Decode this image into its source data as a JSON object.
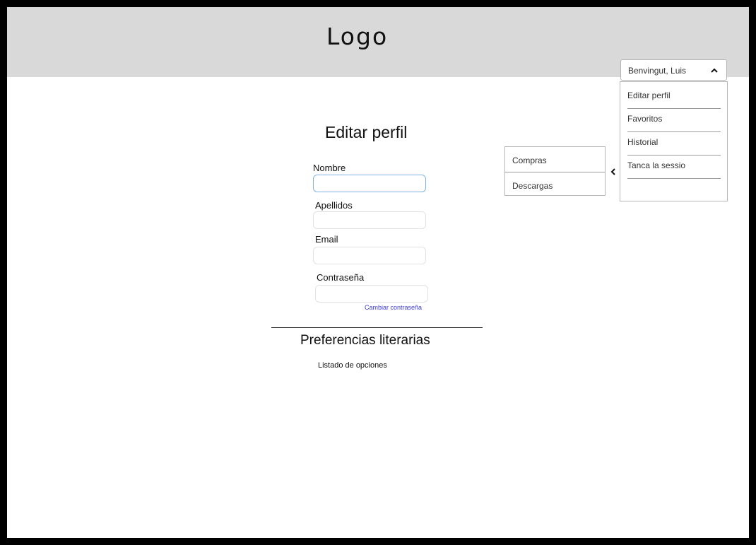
{
  "header": {
    "logo": "Logo"
  },
  "user_menu": {
    "greeting": "Benvingut, Luis",
    "items": [
      {
        "label": "Editar perfil"
      },
      {
        "label": "Favoritos"
      },
      {
        "label": "Historial"
      },
      {
        "label": "Tanca la sessio"
      }
    ]
  },
  "sub_menu": {
    "items": [
      {
        "label": "Compras"
      },
      {
        "label": "Descargas"
      }
    ]
  },
  "form": {
    "title": "Editar perfil",
    "fields": [
      {
        "label": "Nombre",
        "value": ""
      },
      {
        "label": "Apellidos",
        "value": ""
      },
      {
        "label": "Email",
        "value": ""
      },
      {
        "label": "Contraseña",
        "value": ""
      }
    ],
    "change_password": "Cambiar  contraseña"
  },
  "preferences": {
    "title": "Preferencias literarias",
    "options_text": "Listado de opciones"
  },
  "icons": {
    "user_chevron": "chevron-up-icon",
    "submenu_arrow": "chevron-left-icon"
  }
}
